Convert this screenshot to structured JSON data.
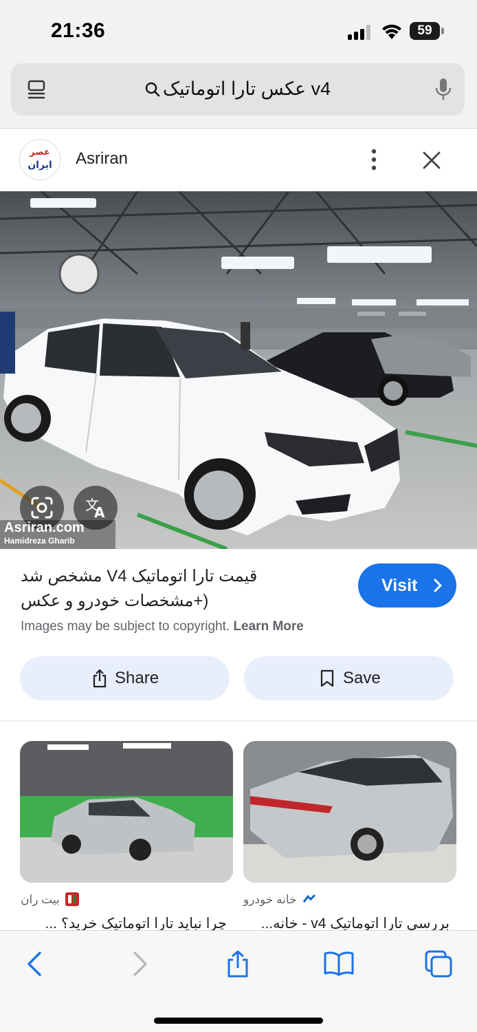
{
  "status_bar": {
    "time": "21:36",
    "battery": "59"
  },
  "address_bar": {
    "query": "عکس تارا اتوماتیک v4"
  },
  "source": {
    "logo_text_top": "عصر",
    "logo_text_bottom": "ایران",
    "name": "Asriran"
  },
  "hero": {
    "watermark_line1": "Asriran.com",
    "watermark_line2": "Hamidreza Gharib"
  },
  "result": {
    "title_line1": "قیمت تارا اتوماتیک V4 مشخص شد",
    "title_line2": "(+مشخصات خودرو و عکس",
    "visit_label": "Visit",
    "copyright_text": "Images may be subject to copyright.",
    "learn_more": "Learn More",
    "share_label": "Share",
    "save_label": "Save"
  },
  "related": [
    {
      "source": "بیت ران",
      "title": "چرا نباید تارا اتوماتیک خرید؟ ..."
    },
    {
      "source": "خانه خودرو",
      "title": "بررسی تارا اتوماتیک v4 - خانه..."
    }
  ],
  "colors": {
    "accent": "#1a73e8",
    "pill_bg": "#e8eefb",
    "chrome_bg": "#f2f2f2"
  }
}
